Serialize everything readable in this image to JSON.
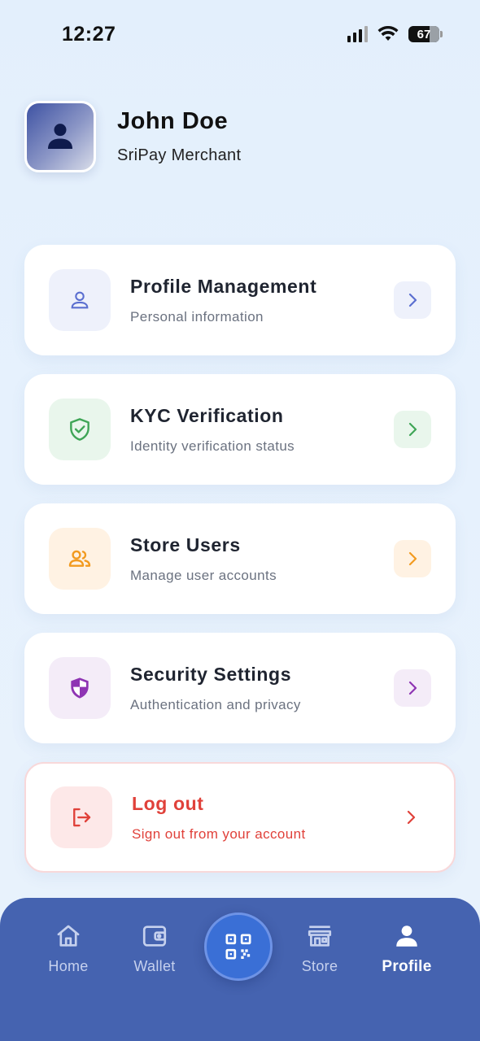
{
  "status": {
    "time": "12:27",
    "battery": "67"
  },
  "header": {
    "name": "John Doe",
    "role": "SriPay Merchant"
  },
  "menu": [
    {
      "title": "Profile Management",
      "subtitle": "Personal information",
      "icon": "person-icon",
      "accent": "#5b6fd0",
      "tint": "#eef1fb"
    },
    {
      "title": "KYC Verification",
      "subtitle": "Identity verification status",
      "icon": "shield-check-icon",
      "accent": "#3fa556",
      "tint": "#e9f6ec"
    },
    {
      "title": "Store Users",
      "subtitle": "Manage user accounts",
      "icon": "users-icon",
      "accent": "#f29a1f",
      "tint": "#fff2e3"
    },
    {
      "title": "Security Settings",
      "subtitle": "Authentication and privacy",
      "icon": "security-shield-icon",
      "accent": "#8e34b3",
      "tint": "#f4ecf8"
    }
  ],
  "logout": {
    "title": "Log out",
    "subtitle": "Sign out from your account",
    "icon": "logout-icon",
    "accent": "#e0413a",
    "tint": "#fde8e8"
  },
  "nav": {
    "items": [
      {
        "label": "Home",
        "icon": "home-icon"
      },
      {
        "label": "Wallet",
        "icon": "wallet-icon"
      },
      {
        "label": "",
        "icon": "qr-scan-icon"
      },
      {
        "label": "Store",
        "icon": "store-icon"
      },
      {
        "label": "Profile",
        "icon": "person-icon",
        "active": true
      }
    ]
  }
}
